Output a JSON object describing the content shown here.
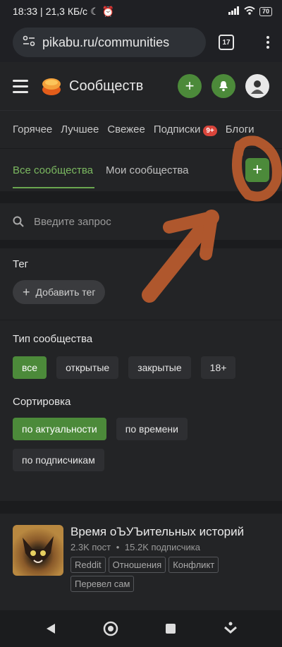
{
  "status_bar": {
    "time": "18:33",
    "speed": "21,3 КБ/с",
    "battery": "70"
  },
  "browser": {
    "url": "pikabu.ru/communities",
    "tabs_count": "17"
  },
  "header": {
    "title": "Сообществ"
  },
  "nav_tabs": [
    {
      "label": "Горячее"
    },
    {
      "label": "Лучшее"
    },
    {
      "label": "Свежее"
    },
    {
      "label": "Подписки",
      "badge": "9+"
    },
    {
      "label": "Блоги"
    }
  ],
  "community_tabs": {
    "all": "Все сообщества",
    "mine": "Мои сообщества"
  },
  "search": {
    "placeholder": "Введите запрос"
  },
  "filters": {
    "tag_label": "Тег",
    "add_tag": "Добавить тег",
    "type_label": "Тип сообщества",
    "types": [
      "все",
      "открытые",
      "закрытые",
      "18+"
    ],
    "sort_label": "Сортировка",
    "sorts": [
      "по актуальности",
      "по времени",
      "по подписчикам"
    ]
  },
  "community": {
    "title": "Время оЪУЪительных историй",
    "posts": "2.3K пост",
    "separator": "•",
    "subscribers": "15.2K подписчика",
    "tags": [
      "Reddit",
      "Отношения",
      "Конфликт",
      "Перевел сам"
    ]
  },
  "colors": {
    "accent": "#4c8a3a",
    "badge": "#d9453b",
    "annotation": "#c8602f"
  }
}
